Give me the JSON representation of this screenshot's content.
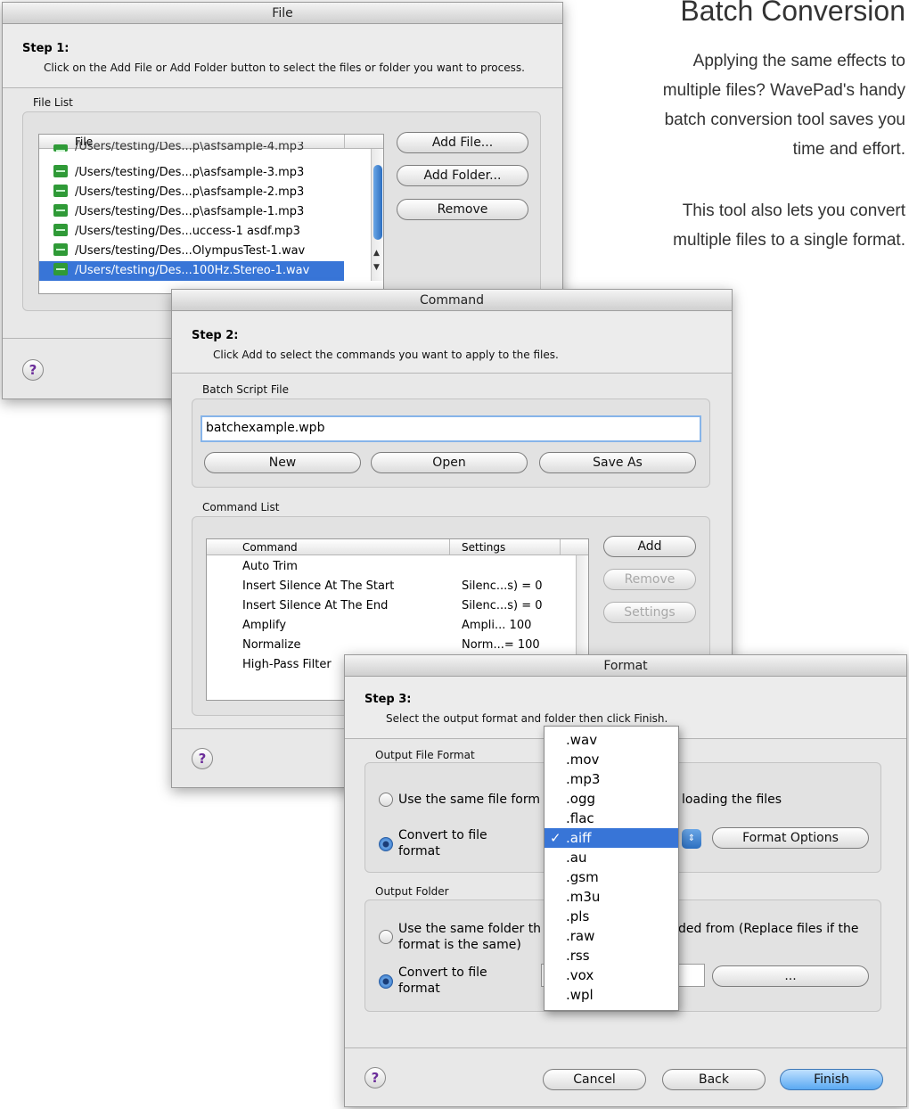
{
  "promo": {
    "title": "Batch Conversion",
    "para1": [
      "Applying the same effects to",
      "multiple files? WavePad's handy",
      "batch conversion tool saves you",
      "time and effort."
    ],
    "para2": [
      "This tool also lets you convert",
      "multiple files to a single format."
    ]
  },
  "file_window": {
    "title": "File",
    "step_title": "Step 1:",
    "step_desc": "Click on the Add File or Add Folder button to select the files or folder you want to process.",
    "group_label": "File List",
    "column": "File",
    "partial_row": "/Users/testing/Des...p\\asfsample-4.mp3",
    "rows": [
      "/Users/testing/Des...p\\asfsample-3.mp3",
      "/Users/testing/Des...p\\asfsample-2.mp3",
      "/Users/testing/Des...p\\asfsample-1.mp3",
      "/Users/testing/Des...uccess-1  asdf.mp3",
      "/Users/testing/Des...OlympusTest-1.wav",
      "/Users/testing/Des...100Hz.Stereo-1.wav"
    ],
    "buttons": {
      "add_file": "Add File...",
      "add_folder": "Add Folder...",
      "remove": "Remove"
    },
    "help": "?"
  },
  "command_window": {
    "title": "Command",
    "step_title": "Step 2:",
    "step_desc": "Click Add to select the commands you want to apply to the files.",
    "script_label": "Batch Script File",
    "script_value": "batchexample.wpb",
    "script_buttons": {
      "new": "New",
      "open": "Open",
      "save_as": "Save As"
    },
    "list_label": "Command List",
    "columns": {
      "command": "Command",
      "settings": "Settings"
    },
    "rows": [
      {
        "command": "Auto Trim",
        "settings": ""
      },
      {
        "command": "Insert Silence At The Start",
        "settings": "Silenc...s) = 0"
      },
      {
        "command": "Insert Silence At The End",
        "settings": "Silenc...s) = 0"
      },
      {
        "command": "Amplify",
        "settings": "Ampli... 100"
      },
      {
        "command": "Normalize",
        "settings": "Norm...= 100"
      },
      {
        "command": "High-Pass Filter",
        "settings": ""
      }
    ],
    "buttons": {
      "add": "Add",
      "remove": "Remove",
      "settings": "Settings"
    },
    "help": "?"
  },
  "format_window": {
    "title": "Format",
    "step_title": "Step 3:",
    "step_desc": "Select the output format and folder then click Finish.",
    "output_format_label": "Output File Format",
    "same_format_a": "Use the same file form",
    "same_format_b": "loading the files",
    "convert_format_1": "Convert to file",
    "convert_format_2": "format",
    "format_options": "Format Options",
    "output_folder_label": "Output Folder",
    "same_folder_a": "Use the same folder th",
    "same_folder_b": "ded from (Replace files if the",
    "same_folder_c": "format is the same)",
    "convert_folder_1": "Convert to file",
    "convert_folder_2": "format",
    "browse": "...",
    "buttons": {
      "cancel": "Cancel",
      "back": "Back",
      "finish": "Finish"
    },
    "help": "?"
  },
  "format_menu": {
    "items": [
      ".wav",
      ".mov",
      ".mp3",
      ".ogg",
      ".flac",
      ".aiff",
      ".au",
      ".gsm",
      ".m3u",
      ".pls",
      ".raw",
      ".rss",
      ".vox",
      ".wpl"
    ],
    "selected": ".aiff",
    "check": "✓"
  }
}
